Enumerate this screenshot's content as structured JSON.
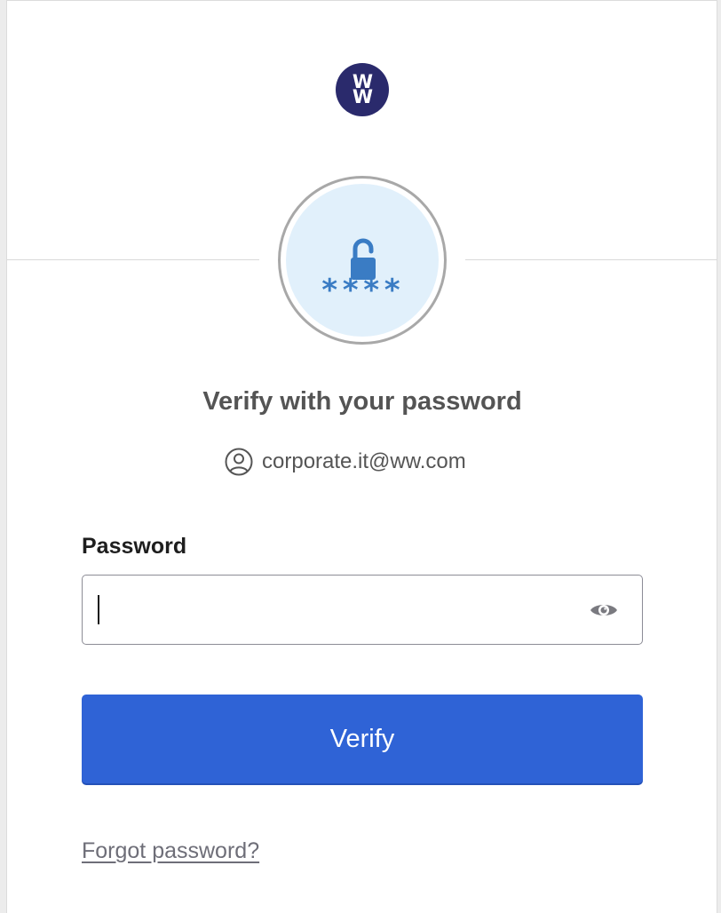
{
  "brand": {
    "logo_line1": "W",
    "logo_line2": "W",
    "logo_color": "#2a2a6c"
  },
  "badge": {
    "icon": "lock-open-icon",
    "mask_text": "****",
    "icon_color": "#3a7cc4",
    "background_color": "#e1f0fb"
  },
  "heading": "Verify with your password",
  "identifier": {
    "icon": "user-circle-icon",
    "email": "corporate.it@ww.com"
  },
  "password": {
    "label": "Password",
    "value": "",
    "placeholder": "",
    "toggle_icon": "eye-icon"
  },
  "verify_button": {
    "label": "Verify",
    "color": "#2f63d6"
  },
  "forgot_link": "Forgot password?"
}
